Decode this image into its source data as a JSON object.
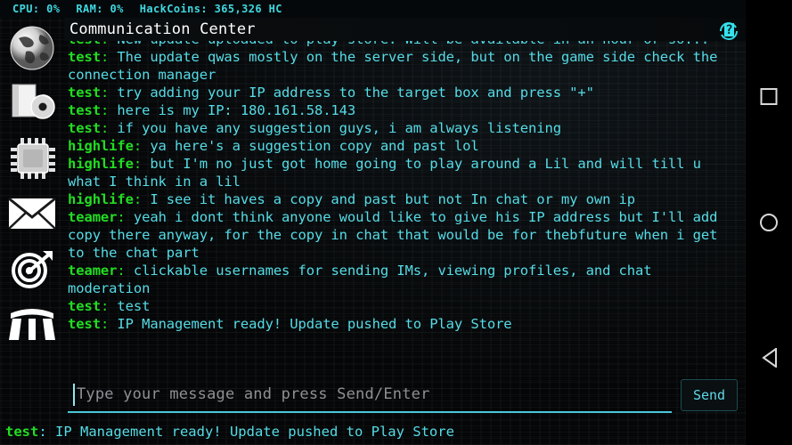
{
  "statusbar": {
    "cpu": "CPU: 0%",
    "ram": "RAM: 0%",
    "hackcoins": "HackCoins: 365,326 HC"
  },
  "header": {
    "title": "Communication Center",
    "help_label": "?"
  },
  "sidebar": {
    "items": [
      {
        "icon": "globe-icon",
        "name": "sidebar-item-network"
      },
      {
        "icon": "software-disc-icon",
        "name": "sidebar-item-software"
      },
      {
        "icon": "cpu-chip-icon",
        "name": "sidebar-item-hardware"
      },
      {
        "icon": "envelope-icon",
        "name": "sidebar-item-mail"
      },
      {
        "icon": "target-arrow-icon",
        "name": "sidebar-item-missions"
      },
      {
        "icon": "bridge-icon",
        "name": "sidebar-item-bridge"
      }
    ]
  },
  "chat": {
    "messages": [
      {
        "user": "test",
        "text": "New update uploaded to play store. Will be available in an hour or so..."
      },
      {
        "user": "test",
        "text": "The update qwas mostly on the server side, but on the game side check the connection manager"
      },
      {
        "user": "test",
        "text": "try adding your IP address to the target box and press \"+\""
      },
      {
        "user": "test",
        "text": "here is my IP: 180.161.58.143"
      },
      {
        "user": "test",
        "text": "if you have any suggestion guys, i am always listening"
      },
      {
        "user": "highlife",
        "text": "ya here's a suggestion copy and past lol"
      },
      {
        "user": "highlife",
        "text": "but I'm no just got home going to play around a Lil and will till u what I think in a lil"
      },
      {
        "user": "highlife",
        "text": "I see it haves a copy and past but not In chat or my own ip"
      },
      {
        "user": "teamer",
        "text": "yeah i dont think anyone would like to give his IP address but I'll add copy there anyway, for the copy in chat that would be for thebfuture when i get to the chat part"
      },
      {
        "user": "teamer",
        "text": "clickable usernames for sending IMs, viewing profiles, and chat moderation"
      },
      {
        "user": "test",
        "text": "test"
      },
      {
        "user": "test",
        "text": "IP Management ready! Update pushed to Play Store"
      }
    ]
  },
  "input": {
    "placeholder": "Type your message and press Send/Enter",
    "value": "",
    "send_label": "Send"
  },
  "bottombar": {
    "user": "test",
    "text": "IP Management ready! Update pushed to Play Store"
  },
  "navrail": {
    "recents": "recents-square",
    "home": "home-circle",
    "back": "back-triangle"
  },
  "colors": {
    "accent_cyan": "#55dce6",
    "username_green": "#22dd22",
    "background": "#050607",
    "placeholder_gray": "#8d9195"
  }
}
